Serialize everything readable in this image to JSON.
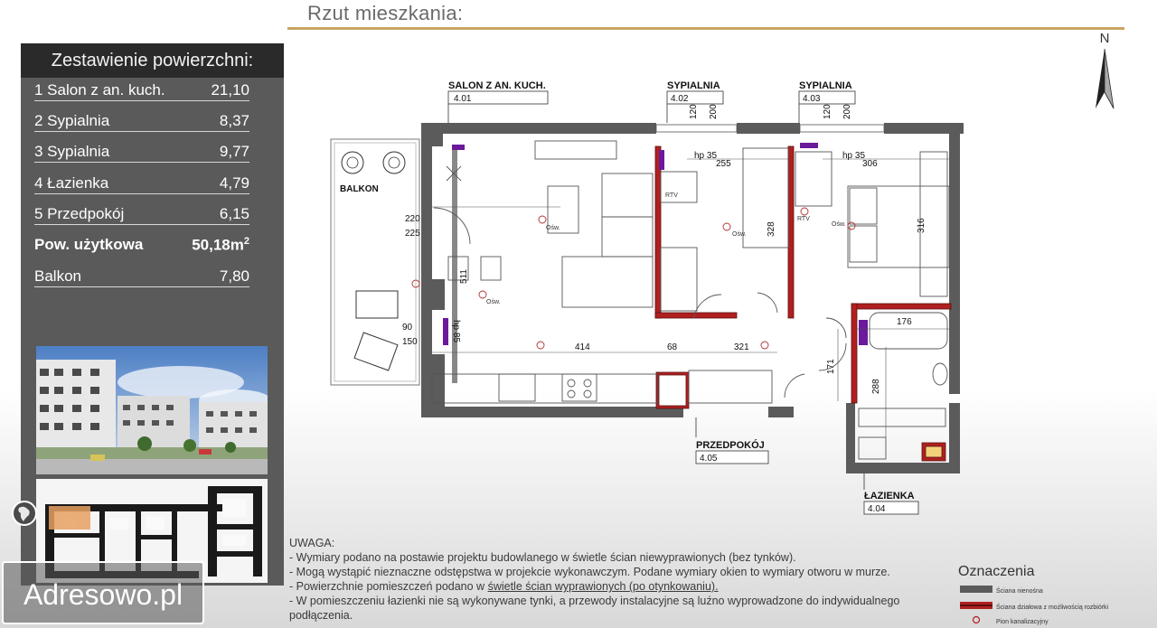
{
  "page": {
    "title": "Rzut mieszkania:",
    "watermark": "Adresowo.pl"
  },
  "summary": {
    "heading": "Zestawienie powierzchni:",
    "rows": [
      {
        "label": "1  Salon z an. kuch.",
        "value": "21,10"
      },
      {
        "label": "2  Sypialnia",
        "value": "8,37"
      },
      {
        "label": "3  Sypialnia",
        "value": "9,77"
      },
      {
        "label": "4  Łazienka",
        "value": "4,79"
      },
      {
        "label": "5  Przedpokój",
        "value": "6,15"
      }
    ],
    "total": {
      "label": "Pow. użytkowa",
      "value": "50,18m",
      "unit": "2"
    },
    "balcony": {
      "label": "Balkon",
      "value": "7,80"
    }
  },
  "plan": {
    "north": "N",
    "rooms": [
      {
        "name": "SALON Z AN. KUCH.",
        "number": "4.01"
      },
      {
        "name": "SYPIALNIA",
        "number": "4.02"
      },
      {
        "name": "SYPIALNIA",
        "number": "4.03"
      },
      {
        "name": "PRZEDPOKÓJ",
        "number": "4.05"
      },
      {
        "name": "ŁAZIENKA",
        "number": "4.04"
      }
    ],
    "balcony_label": "BALKON",
    "dims": [
      "120",
      "200",
      "120",
      "200",
      "hp 35",
      "255",
      "hp 35",
      "306",
      "220",
      "225",
      "328",
      "316",
      "511",
      "90",
      "150",
      "hp 85",
      "414",
      "68",
      "321",
      "176",
      "171",
      "288"
    ],
    "fixture_labels": [
      "RTV",
      "RTV",
      "Ośw.",
      "Ośw.",
      "Ośw.",
      "Ośw."
    ]
  },
  "notes": {
    "heading": "UWAGA:",
    "lines": [
      "- Wymiary podano na postawie projektu budowlanego w świetle ścian niewyprawionych (bez tynków).",
      "- Mogą wystąpić nieznaczne odstępstwa w projekcie wykonawczym. Podane wymiary okien to wymiary otworu w murze."
    ],
    "line3_pre": "- Powierzchnie pomieszczeń podano w ",
    "line3_link": "świetle ścian wyprawionych (po otynkowaniu).",
    "line4": "- W pomieszczeniu łazienki nie są wykonywane tynki, a przewody instalacyjne są luźno wyprowadzone do indywidualnego",
    "line5": "  podłączenia."
  },
  "legend": {
    "title": "Oznaczenia",
    "items": [
      "Ściana nienośna",
      "Ściana działowa z możliwością rozbiórki",
      "Pion kanalizacyjny"
    ]
  },
  "colors": {
    "wall": "#5b5b5b",
    "partition": "#b02020",
    "gold": "#c8a463",
    "panel": "#5a5a5a"
  }
}
